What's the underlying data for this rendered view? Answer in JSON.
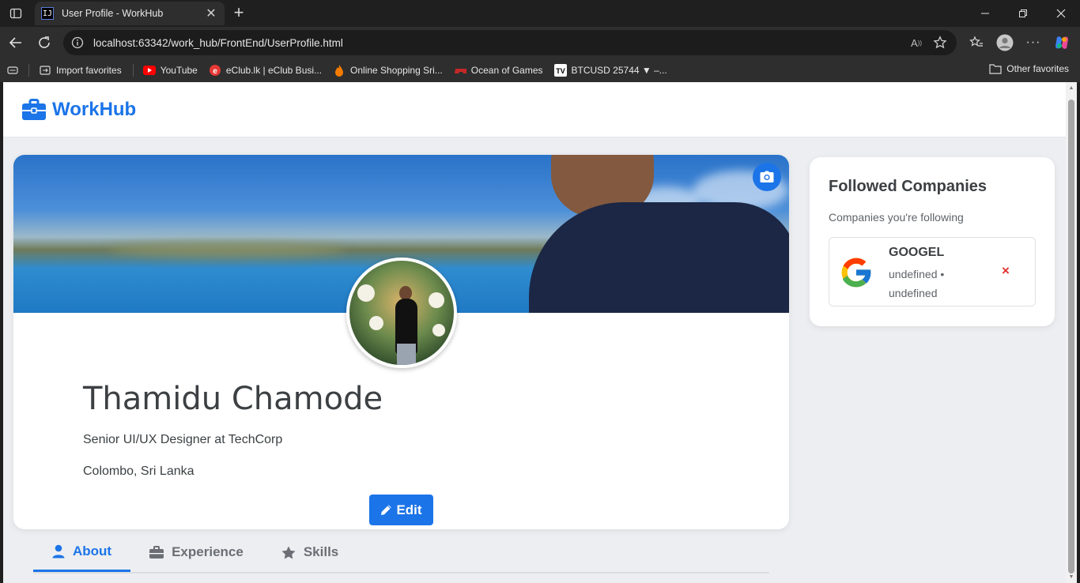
{
  "browser": {
    "tab_title": "User Profile - WorkHub",
    "tab_favicon": "IJ",
    "url": "localhost:63342/work_hub/FrontEnd/UserProfile.html",
    "bookmarks": [
      {
        "label": "Import favorites",
        "icon": "import-icon"
      },
      {
        "label": "YouTube",
        "icon": "youtube-icon"
      },
      {
        "label": "eClub.lk | eClub Busi...",
        "icon": "eclub-icon"
      },
      {
        "label": "Online Shopping Sri...",
        "icon": "shopping-icon"
      },
      {
        "label": "Ocean of Games",
        "icon": "games-icon"
      },
      {
        "label": "BTCUSD 25744 ▼ –...",
        "icon": "tradingview-icon"
      }
    ],
    "other_favorites": "Other favorites"
  },
  "site": {
    "logo": "WorkHub",
    "brand_color": "#1b74e8"
  },
  "profile": {
    "name": "Thamidu Chamode",
    "title": "Senior UI/UX Designer at TechCorp",
    "location": "Colombo, Sri Lanka",
    "edit_label": "Edit"
  },
  "tabs": [
    {
      "label": "About",
      "icon": "user-icon",
      "active": true
    },
    {
      "label": "Experience",
      "icon": "briefcase-icon",
      "active": false
    },
    {
      "label": "Skills",
      "icon": "star-icon",
      "active": false
    }
  ],
  "followed": {
    "title": "Followed Companies",
    "subtitle": "Companies you're following",
    "companies": [
      {
        "name": "GOOGEL",
        "meta": "undefined • undefined",
        "logo": "google-logo",
        "remove": "×"
      }
    ]
  },
  "colors": {
    "accent": "#1b74e8",
    "danger": "#e0302e"
  }
}
